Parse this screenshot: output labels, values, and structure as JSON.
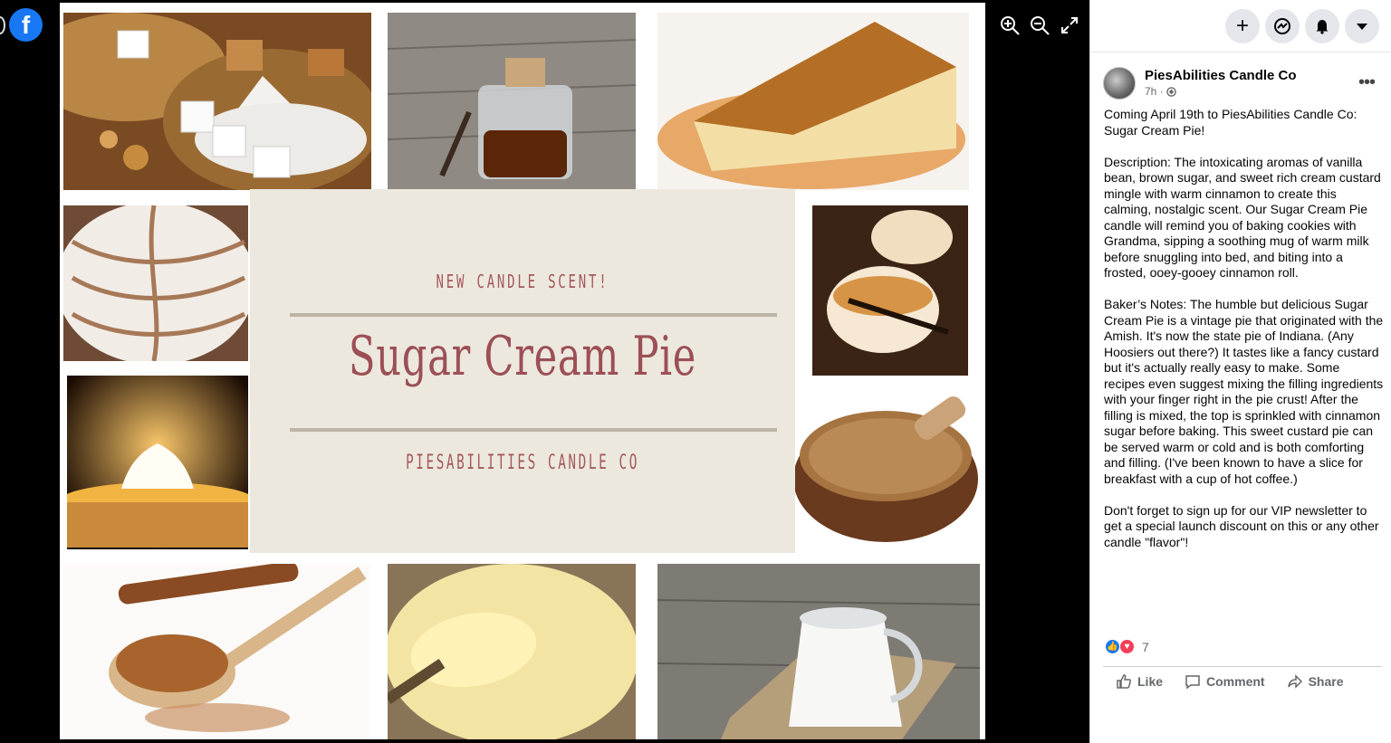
{
  "app": {
    "logo_letter": "f"
  },
  "viewer": {
    "card": {
      "kicker": "NEW CANDLE SCENT!",
      "title": "Sugar Cream Pie",
      "footer": "PIESABILITIES CANDLE CO"
    },
    "controls": [
      "zoom-in-icon",
      "zoom-out-icon",
      "fullscreen-icon"
    ]
  },
  "topbar": {
    "buttons": [
      "plus-icon",
      "messenger-icon",
      "bell-icon",
      "caret-down-icon"
    ]
  },
  "post": {
    "page_name": "PiesAbilities Candle Co",
    "time": "7h ·",
    "paragraphs": [
      "Coming April 19th to PiesAbilities Candle Co: Sugar Cream Pie!",
      "Description: The intoxicating aromas of vanilla bean, brown sugar, and sweet rich cream custard mingle with warm cinnamon to create this calming, nostalgic scent. Our Sugar Cream Pie candle will remind you of baking cookies with Grandma, sipping a soothing mug of warm milk before snuggling into bed, and biting into a frosted, ooey-gooey cinnamon roll.",
      "Baker’s Notes: The humble but delicious Sugar Cream Pie is a vintage pie that originated with the Amish. It's now the state pie of Indiana. (Any Hoosiers out there?) It tastes like a fancy custard but it's actually really easy to make. Some recipes even suggest mixing the filling ingredients with your finger right in the pie crust! After the filling is mixed, the top is sprinkled with cinnamon sugar before baking. This sweet custard pie can be served warm or cold and is both comforting and filling. (I've been known to have a slice for breakfast with a cup of hot coffee.)",
      "Don't forget to sign up for our VIP newsletter to get a special launch discount on this or any other candle \"flavor\"!"
    ],
    "reaction_count": "7",
    "actions": {
      "like": "Like",
      "comment": "Comment",
      "share": "Share"
    }
  }
}
